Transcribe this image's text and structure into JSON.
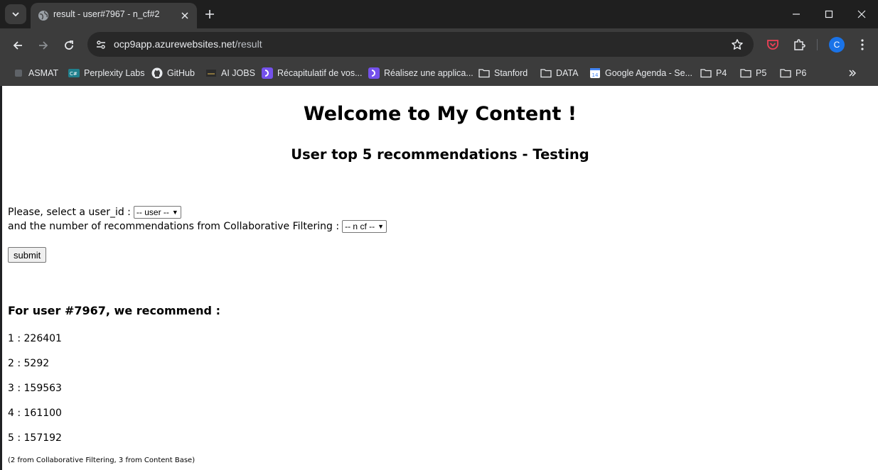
{
  "browser": {
    "tab_title": "result - user#7967 - n_cf#2",
    "url_host": "ocp9app.azurewebsites.net",
    "url_path": "/result",
    "profile_initial": "C",
    "bookmarks": [
      {
        "label": "ASMAT",
        "icon": "bookmark-favicon-icon"
      },
      {
        "label": "Perplexity Labs",
        "icon": "perplexity-icon"
      },
      {
        "label": "GitHub",
        "icon": "github-icon"
      },
      {
        "label": "AI JOBS",
        "icon": "ai-jobs-icon"
      },
      {
        "label": "Récapitulatif de vos...",
        "icon": "openclassrooms-icon"
      },
      {
        "label": "Réalisez une applica...",
        "icon": "openclassrooms-icon"
      },
      {
        "label": "Stanford",
        "icon": "folder-icon"
      },
      {
        "label": "DATA",
        "icon": "folder-icon"
      },
      {
        "label": "Google Agenda - Se...",
        "icon": "google-calendar-icon"
      },
      {
        "label": "P4",
        "icon": "folder-icon"
      },
      {
        "label": "P5",
        "icon": "folder-icon"
      },
      {
        "label": "P6",
        "icon": "folder-icon"
      }
    ],
    "colors": {
      "chrome_dark": "#1f1f1f",
      "toolbar": "#3c3c3c",
      "omnibox": "#282828",
      "avatar": "#1a73e8",
      "pocket": "#ef4056"
    }
  },
  "page": {
    "title": "Welcome to My Content !",
    "subtitle": "User top 5 recommendations - Testing",
    "form": {
      "user_label": "Please, select a user_id :",
      "user_select_value": "-- user --",
      "ncf_label": "and the number of recommendations from Collaborative Filtering :",
      "ncf_select_value": "-- n cf --",
      "submit_label": "submit"
    },
    "result_heading": "For user #7967, we recommend :",
    "recommendations": [
      {
        "text": "1 : 226401"
      },
      {
        "text": "2 : 5292"
      },
      {
        "text": "3 : 159563"
      },
      {
        "text": "4 : 161100"
      },
      {
        "text": "5 : 157192"
      }
    ],
    "note": "(2 from Collaborative Filtering, 3 from Content Base)"
  }
}
